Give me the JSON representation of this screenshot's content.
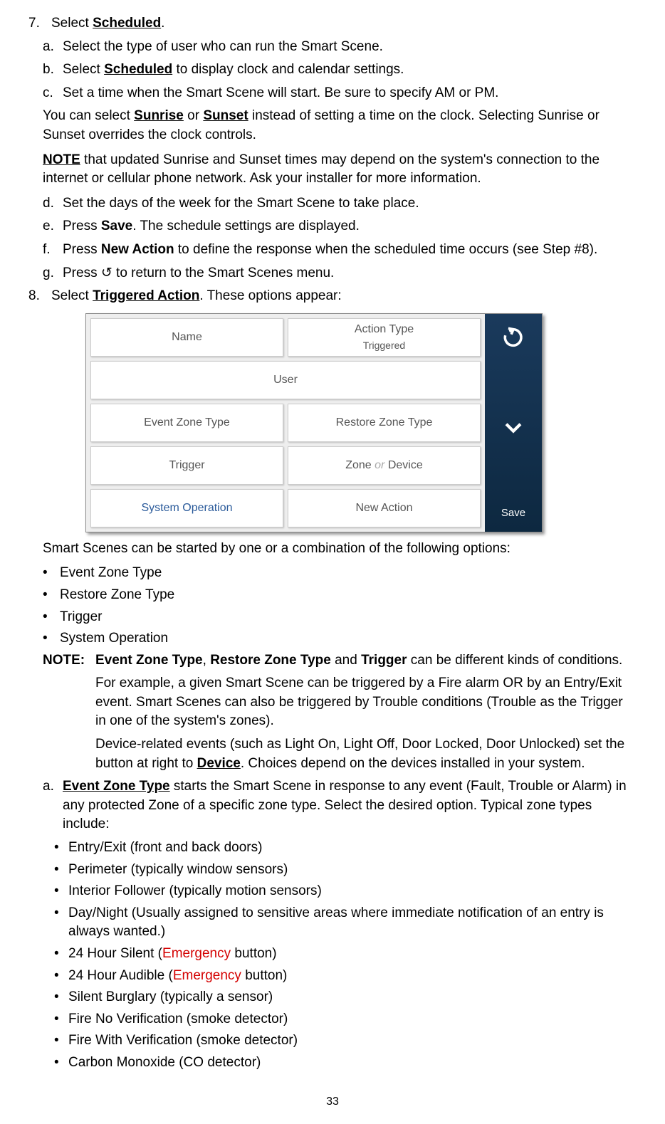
{
  "step7": {
    "num": "7.",
    "text_pre": "Select ",
    "text_bold": "Scheduled",
    "text_post": ".",
    "a": {
      "letter": "a.",
      "text": "Select the type of user who can run the Smart Scene."
    },
    "b": {
      "letter": "b.",
      "pre": "Select ",
      "bold": "Scheduled",
      "post": " to display clock and calendar settings."
    },
    "c": {
      "letter": "c.",
      "text": "Set a time when the Smart Scene will start. Be sure to specify AM or PM."
    },
    "p1": {
      "pre": "You can select ",
      "b1": "Sunrise",
      "mid": " or ",
      "b2": "Sunset",
      "post": " instead of setting a time on the clock. Selecting Sunrise or Sunset overrides the clock controls."
    },
    "p2": {
      "note": "NOTE",
      "post": " that updated Sunrise and Sunset times may depend on the system's connection to the internet or cellular phone network. Ask your installer for more information."
    },
    "d": {
      "letter": "d.",
      "text": "Set the days of the week for the Smart Scene to take place."
    },
    "e": {
      "letter": "e.",
      "pre": "Press ",
      "bold": "Save",
      "post": ". The schedule settings are displayed."
    },
    "f": {
      "letter": "f.",
      "pre": "Press ",
      "bold": "New Action",
      "post": " to define the response when the scheduled time occurs (see Step #8)."
    },
    "g": {
      "letter": "g.",
      "pre": "Press ",
      "sym": "↺",
      "post": " to return to the Smart Scenes menu."
    }
  },
  "step8": {
    "num": "8.",
    "pre": "Select ",
    "bold": "Triggered Action",
    "post": ". These options appear:",
    "ui": {
      "name": "Name",
      "action_type": "Action Type",
      "triggered": "Triggered",
      "user": "User",
      "event_zone": "Event Zone Type",
      "restore_zone": "Restore Zone Type",
      "trigger": "Trigger",
      "zone_or_device_pre": "Zone ",
      "zone_or_device_or": "or",
      "zone_or_device_post": " Device",
      "sys_op": "System Operation",
      "new_action": "New Action",
      "save": "Save"
    },
    "after_fig": "Smart Scenes can be started by one or a combination of the following options:",
    "bullets": {
      "b1": "Event Zone Type",
      "b2": "Restore Zone Type",
      "b3": "Trigger",
      "b4": "System Operation"
    },
    "note": {
      "label": "NOTE:",
      "line1_b1": "Event Zone Type",
      "line1_sep1": ", ",
      "line1_b2": "Restore Zone Type",
      "line1_sep2": " and ",
      "line1_b3": "Trigger",
      "line1_post": " can be different kinds of conditions.",
      "line2": "For example, a given Smart Scene can be triggered by a Fire alarm OR by an Entry/Exit event. Smart Scenes can also be triggered by Trouble conditions (Trouble as the Trigger in one of the system's zones).",
      "line3_pre": "Device-related events (such as Light On, Light Off, Door Locked, Door Unlocked) set the button at right to ",
      "line3_bold": "Device",
      "line3_post": ". Choices depend on the devices installed in your system."
    },
    "a": {
      "letter": "a.",
      "bold": "Event Zone Type",
      "post": " starts the Smart Scene in response to any event (Fault, Trouble or Alarm) in any protected Zone of a specific zone type. Select the desired option. Typical zone types include:",
      "list": {
        "i1": "Entry/Exit (front and back doors)",
        "i2": "Perimeter (typically window sensors)",
        "i3": "Interior Follower (typically motion sensors)",
        "i4": "Day/Night (Usually assigned to sensitive areas where immediate notification of an entry is always wanted.)",
        "i5_pre": "24 Hour Silent (",
        "i5_red": "Emergency",
        "i5_post": " button)",
        "i6_pre": "24 Hour Audible (",
        "i6_red": "Emergency",
        "i6_post": " button)",
        "i7": "Silent Burglary (typically a sensor)",
        "i8": "Fire No Verification (smoke detector)",
        "i9": "Fire With Verification (smoke detector)",
        "i10": "Carbon Monoxide (CO detector)"
      }
    }
  },
  "page": "33"
}
